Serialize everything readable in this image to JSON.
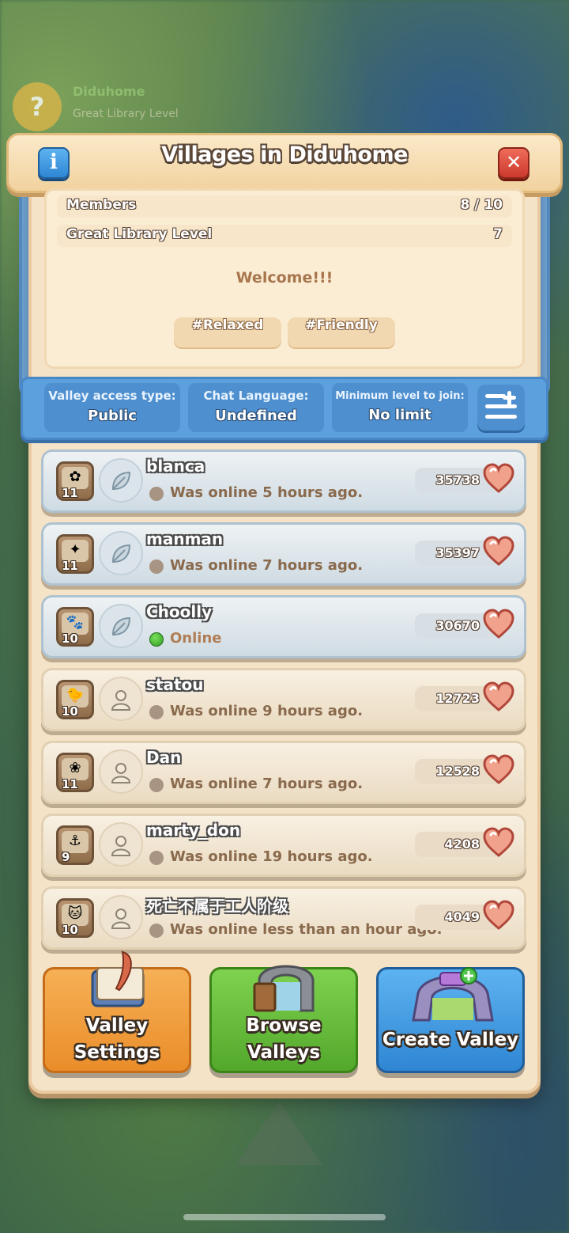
{
  "background": {
    "player_name": "Diduhome",
    "player_sub": "Great Library Level"
  },
  "dialog": {
    "title": "Villages in Diduhome",
    "info_icon": "info-icon",
    "close_icon": "close-icon"
  },
  "stats": {
    "members_label": "Members",
    "members_value": "8 / 10",
    "library_label": "Great Library Level",
    "library_value": "7"
  },
  "welcome": "Welcome!!!",
  "tags": [
    "#Relaxed",
    "#Friendly"
  ],
  "settings": {
    "access_label": "Valley access type:",
    "access_value": "Public",
    "language_label": "Chat Language:",
    "language_value": "Undefined",
    "minlevel_label": "Minimum level to join:",
    "minlevel_value": "No limit"
  },
  "members": [
    {
      "name": "blanca",
      "level": "11",
      "status": "Was online 5 hours ago.",
      "points": "35738",
      "online": false,
      "role": "leaf-icon",
      "style": "blue"
    },
    {
      "name": "manman",
      "level": "11",
      "status": "Was online 7 hours ago.",
      "points": "35397",
      "online": false,
      "role": "leaf-icon",
      "style": "blue"
    },
    {
      "name": "Choolly",
      "level": "10",
      "status": "Online",
      "points": "30670",
      "online": true,
      "role": "leaf-icon",
      "style": "blue"
    },
    {
      "name": "statou",
      "level": "10",
      "status": "Was online 9 hours ago.",
      "points": "12723",
      "online": false,
      "role": "person-icon",
      "style": "tan"
    },
    {
      "name": "Dan",
      "level": "11",
      "status": "Was online 7 hours ago.",
      "points": "12528",
      "online": false,
      "role": "person-icon",
      "style": "tan"
    },
    {
      "name": "marty_don",
      "level": "9",
      "status": "Was online 19 hours ago.",
      "points": "4208",
      "online": false,
      "role": "person-icon",
      "style": "tan"
    },
    {
      "name": "死亡不属于工人阶级",
      "level": "10",
      "status": "Was online less than an hour ago.",
      "points": "4049",
      "online": false,
      "role": "person-icon",
      "style": "tan"
    }
  ],
  "buttons": {
    "valley_settings_1": "Valley",
    "valley_settings_2": "Settings",
    "browse_1": "Browse",
    "browse_2": "Valleys",
    "create": "Create Valley"
  },
  "colors": {
    "orange_button": "#ea8d2a",
    "green_button": "#53a82c",
    "blue_button": "#2f86d3",
    "online_dot": "#2e9a24"
  }
}
